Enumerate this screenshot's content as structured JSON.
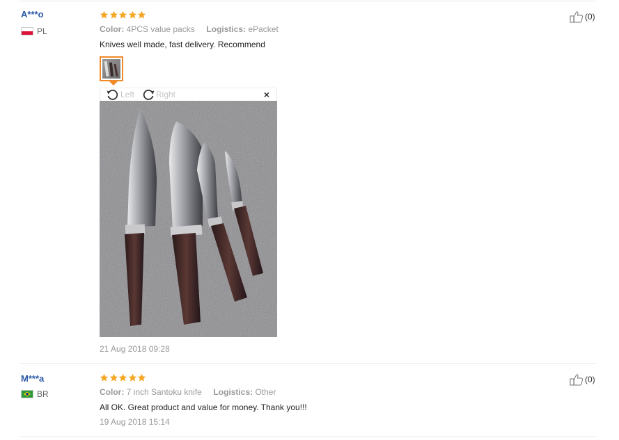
{
  "reviews": [
    {
      "user": "A***o",
      "country": "PL",
      "rating": 5,
      "color_label": "Color:",
      "color_value": "4PCS value packs",
      "logistics_label": "Logistics:",
      "logistics_value": "ePacket",
      "text": "Knives well made, fast delivery. Recommend",
      "date": "21 Aug 2018 09:28",
      "helpful_count": "(0)"
    },
    {
      "user": "M***a",
      "country": "BR",
      "rating": 5,
      "color_label": "Color:",
      "color_value": "7 inch Santoku knife",
      "logistics_label": "Logistics:",
      "logistics_value": "Other",
      "text": "All OK. Great product and value for money. Thank you!!!",
      "date": "19 Aug 2018 15:14",
      "helpful_count": "(0)"
    }
  ],
  "viewer": {
    "rotate_left_label": "Left",
    "rotate_right_label": "Right",
    "close_label": "×"
  },
  "colors": {
    "username": "#2b5aa6",
    "star": "#f5a623",
    "thumb_border": "#f08a28",
    "meta_text": "#999999"
  },
  "icons": [
    "thumbs-up-icon",
    "rotate-left-icon",
    "rotate-right-icon",
    "close-icon",
    "star-icon",
    "flag-pl-icon",
    "flag-br-icon"
  ]
}
